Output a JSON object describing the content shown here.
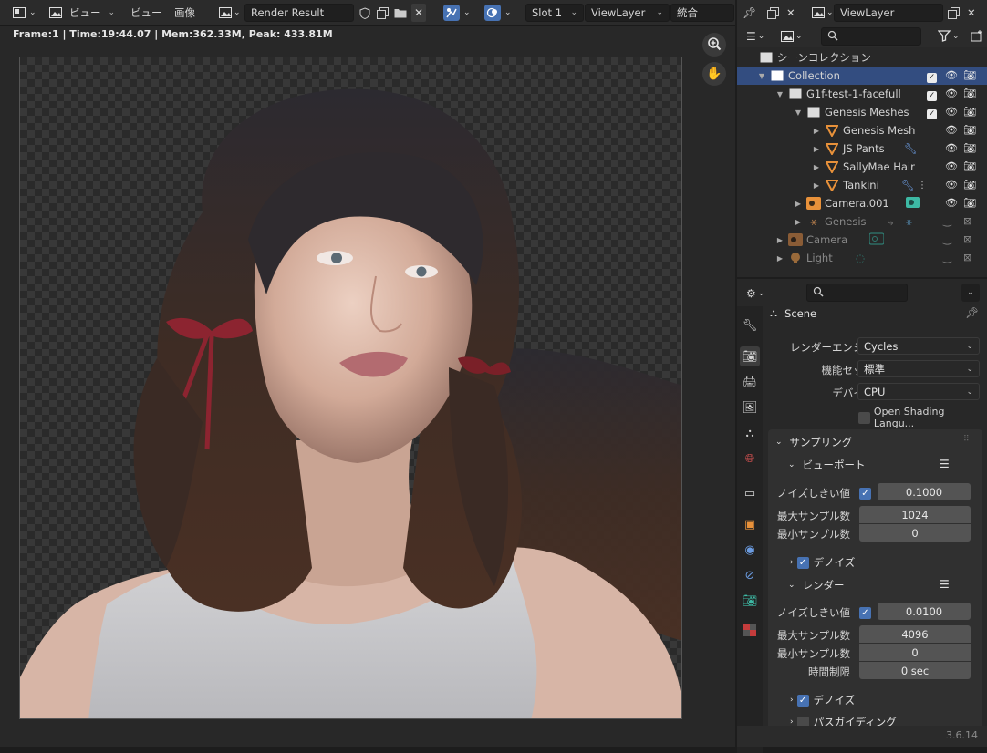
{
  "image_editor": {
    "header": {
      "view_menu": "ビュー",
      "view_menu2": "ビュー",
      "image_menu": "画像",
      "image_name": "Render Result",
      "slot": "Slot 1",
      "view_layer": "ViewLayer",
      "pass": "統合"
    },
    "stats": "Frame:1 | Time:19:44.07 | Mem:362.33M, Peak: 433.81M"
  },
  "outliner": {
    "header": {
      "view_layer": "ViewLayer",
      "search_placeholder": ""
    },
    "scene_collection": "シーンコレクション",
    "rows": [
      {
        "label": "Collection",
        "selected": true
      },
      {
        "label": "G1f-test-1-facefull"
      },
      {
        "label": "Genesis Meshes"
      },
      {
        "label": "Genesis Mesh"
      },
      {
        "label": "JS Pants"
      },
      {
        "label": "SallyMae Hair"
      },
      {
        "label": "Tankini"
      },
      {
        "label": "Camera.001"
      },
      {
        "label": "Genesis"
      },
      {
        "label": "Camera"
      },
      {
        "label": "Light"
      }
    ]
  },
  "properties": {
    "context": "Scene",
    "render_engine_label": "レンダーエンジン",
    "render_engine": "Cycles",
    "feature_set_label": "機能セット",
    "feature_set": "標準",
    "device_label": "デバイス",
    "device": "CPU",
    "osl_label": "Open Shading Langu...",
    "sampling_header": "サンプリング",
    "viewport": {
      "header": "ビューポート",
      "noise_threshold_label": "ノイズしきい値",
      "noise_threshold": "0.1000",
      "max_samples_label": "最大サンプル数",
      "max_samples": "1024",
      "min_samples_label": "最小サンプル数",
      "min_samples": "0",
      "denoise_label": "デノイズ"
    },
    "render": {
      "header": "レンダー",
      "noise_threshold_label": "ノイズしきい値",
      "noise_threshold": "0.0100",
      "max_samples_label": "最大サンプル数",
      "max_samples": "4096",
      "min_samples_label": "最小サンプル数",
      "min_samples": "0",
      "time_limit_label": "時間制限",
      "time_limit": "0 sec",
      "denoise_label": "デノイズ"
    },
    "path_guiding_label": "パスガイディング"
  },
  "status": {
    "version": "3.6.14"
  },
  "colors": {
    "accent": "#4772b3",
    "selected_row": "#334d80",
    "object_orange": "#e8913a",
    "camera_teal": "#3db9a4"
  }
}
